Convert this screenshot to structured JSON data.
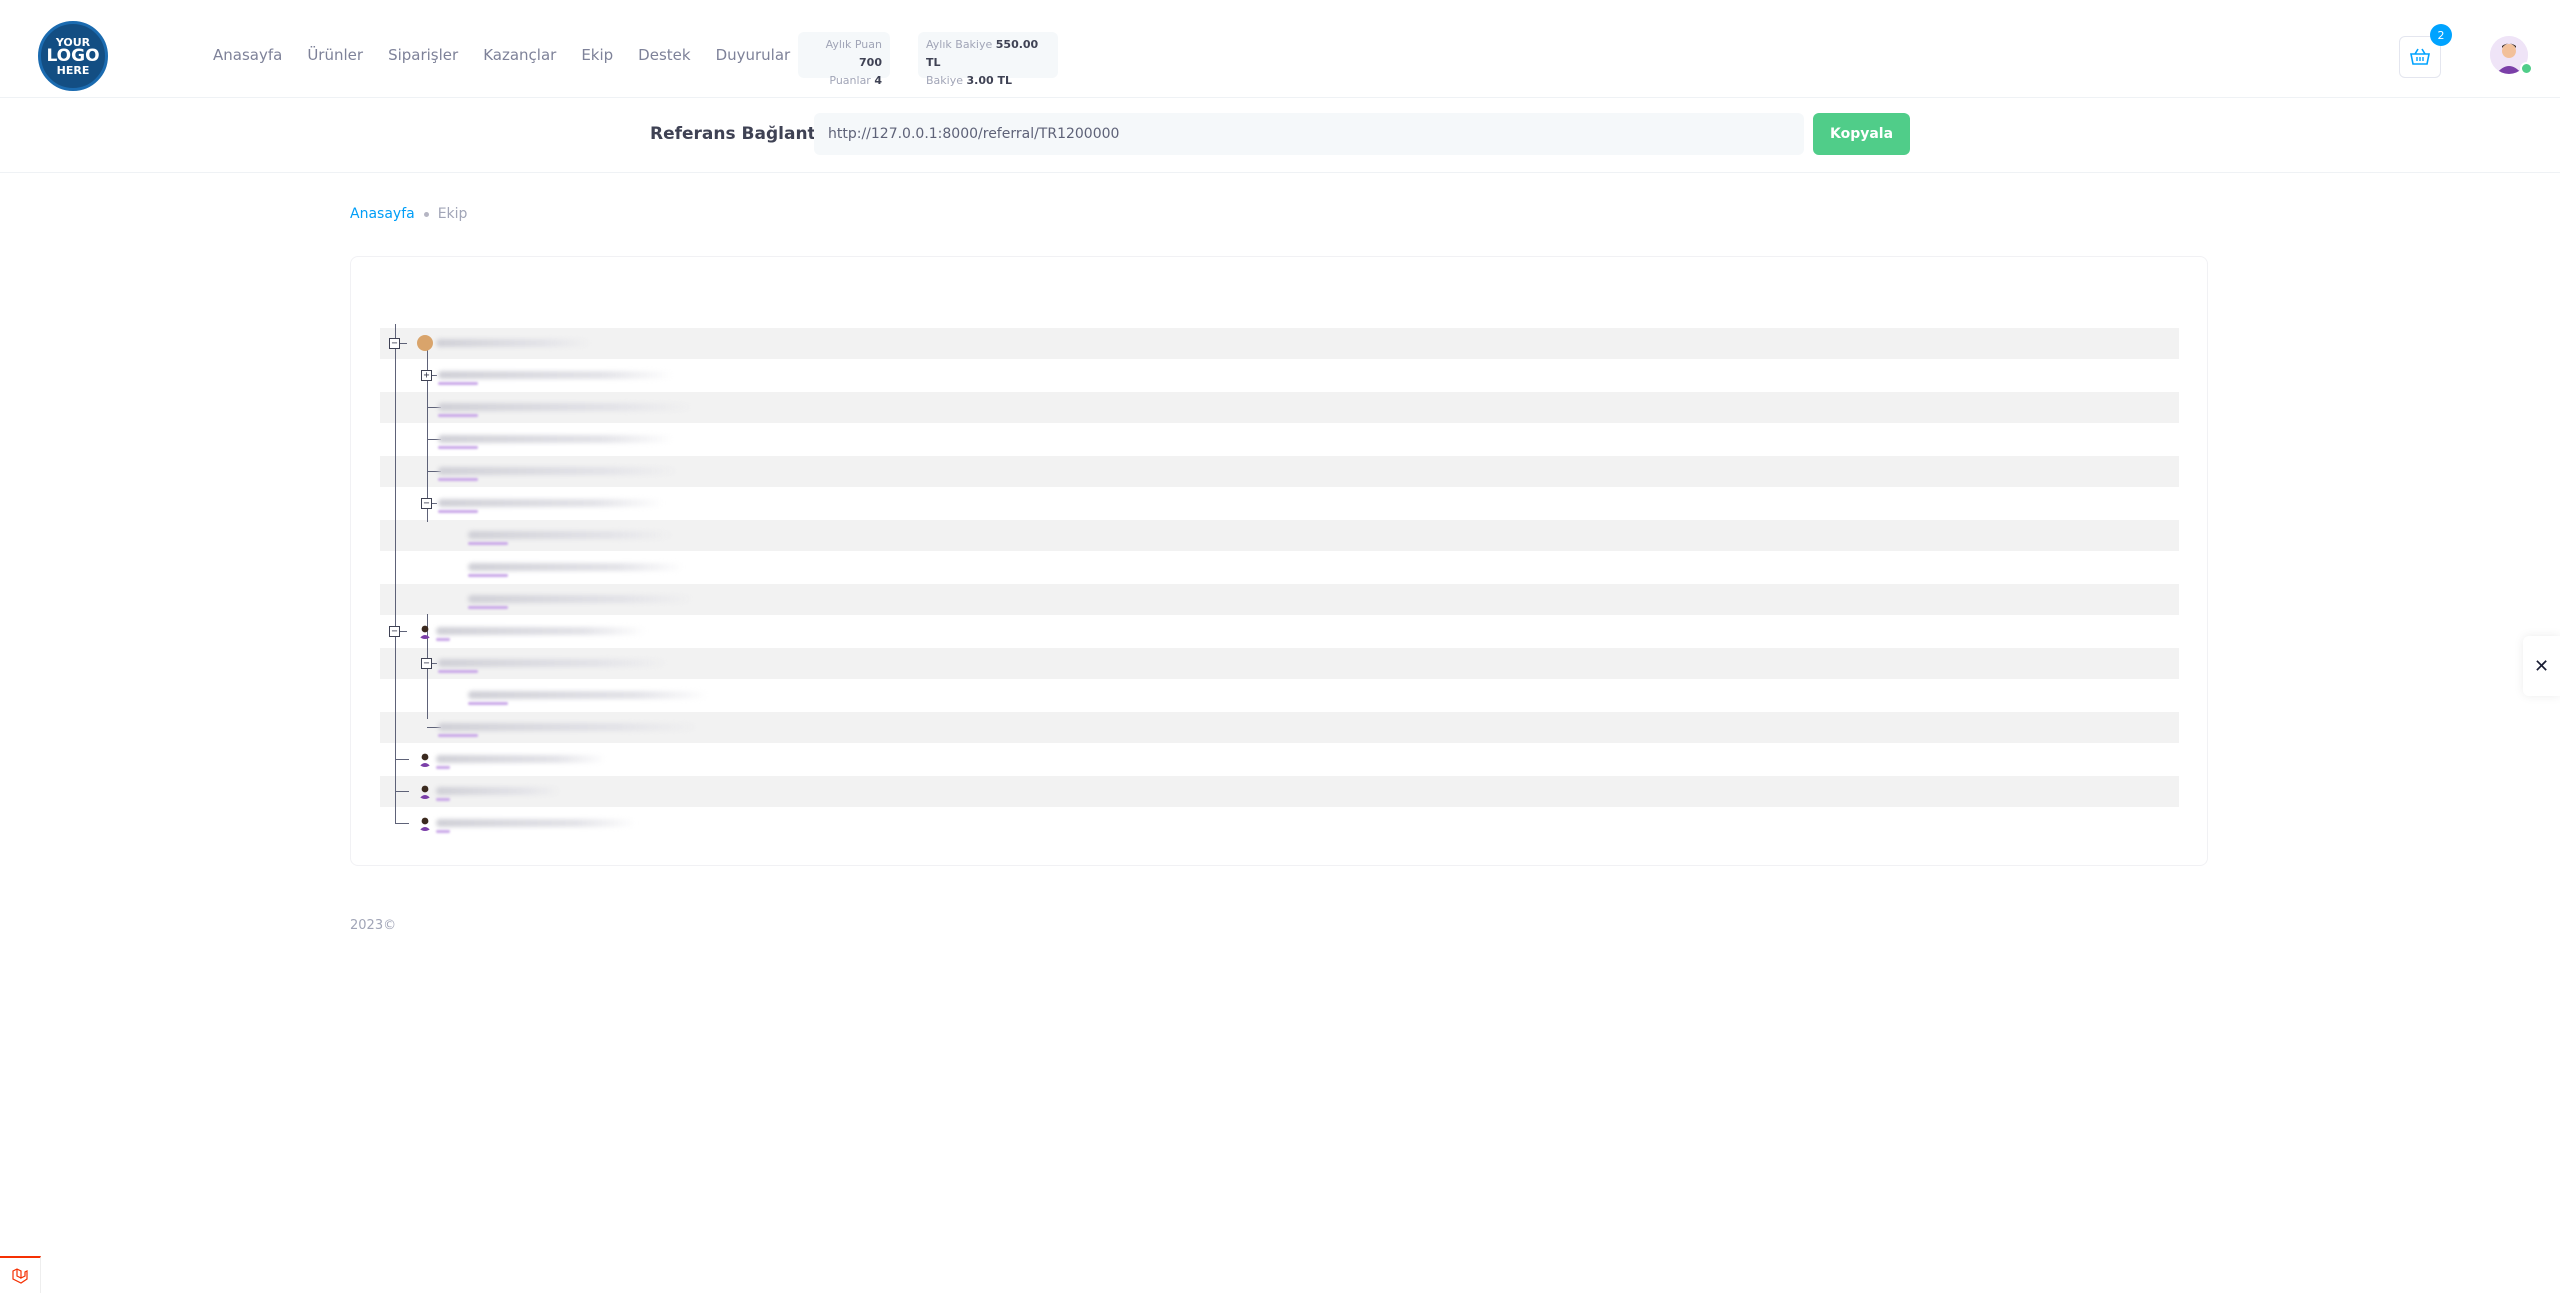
{
  "header": {
    "logo": {
      "line1": "YOUR",
      "line2": "LOGO",
      "line3": "HERE"
    },
    "nav": [
      "Anasayfa",
      "Ürünler",
      "Siparişler",
      "Kazançlar",
      "Ekip",
      "Destek",
      "Duyurular"
    ],
    "stats_points": {
      "monthly_label": "Aylık Puan",
      "monthly_value": "700",
      "points_label": "Puanlar",
      "points_value": "4"
    },
    "stats_balance": {
      "monthly_label": "Aylık Bakiye",
      "monthly_value": "550.00 TL",
      "balance_label": "Bakiye",
      "balance_value": "3.00 TL"
    },
    "cart_count": "2",
    "cart_icon": "basket-icon",
    "avatar_icon": "user-avatar-icon"
  },
  "referral": {
    "label": "Referans Bağlantısı",
    "url": "http://127.0.0.1:8000/referral/TR1200000",
    "copy_button": "Kopyala"
  },
  "breadcrumb": {
    "home": "Anasayfa",
    "current": "Ekip"
  },
  "tree": {
    "toggle_expanded": "−",
    "toggle_collapsed": "+",
    "name_visibility": "blurred"
  },
  "footer": {
    "copyright": "2023©"
  },
  "close_panel": {
    "icon": "close-icon",
    "glyph": "✕"
  },
  "colors": {
    "accent": "#009ef7",
    "success": "#50cd89",
    "badge": "#00a3ff",
    "logo": "#134e83"
  }
}
